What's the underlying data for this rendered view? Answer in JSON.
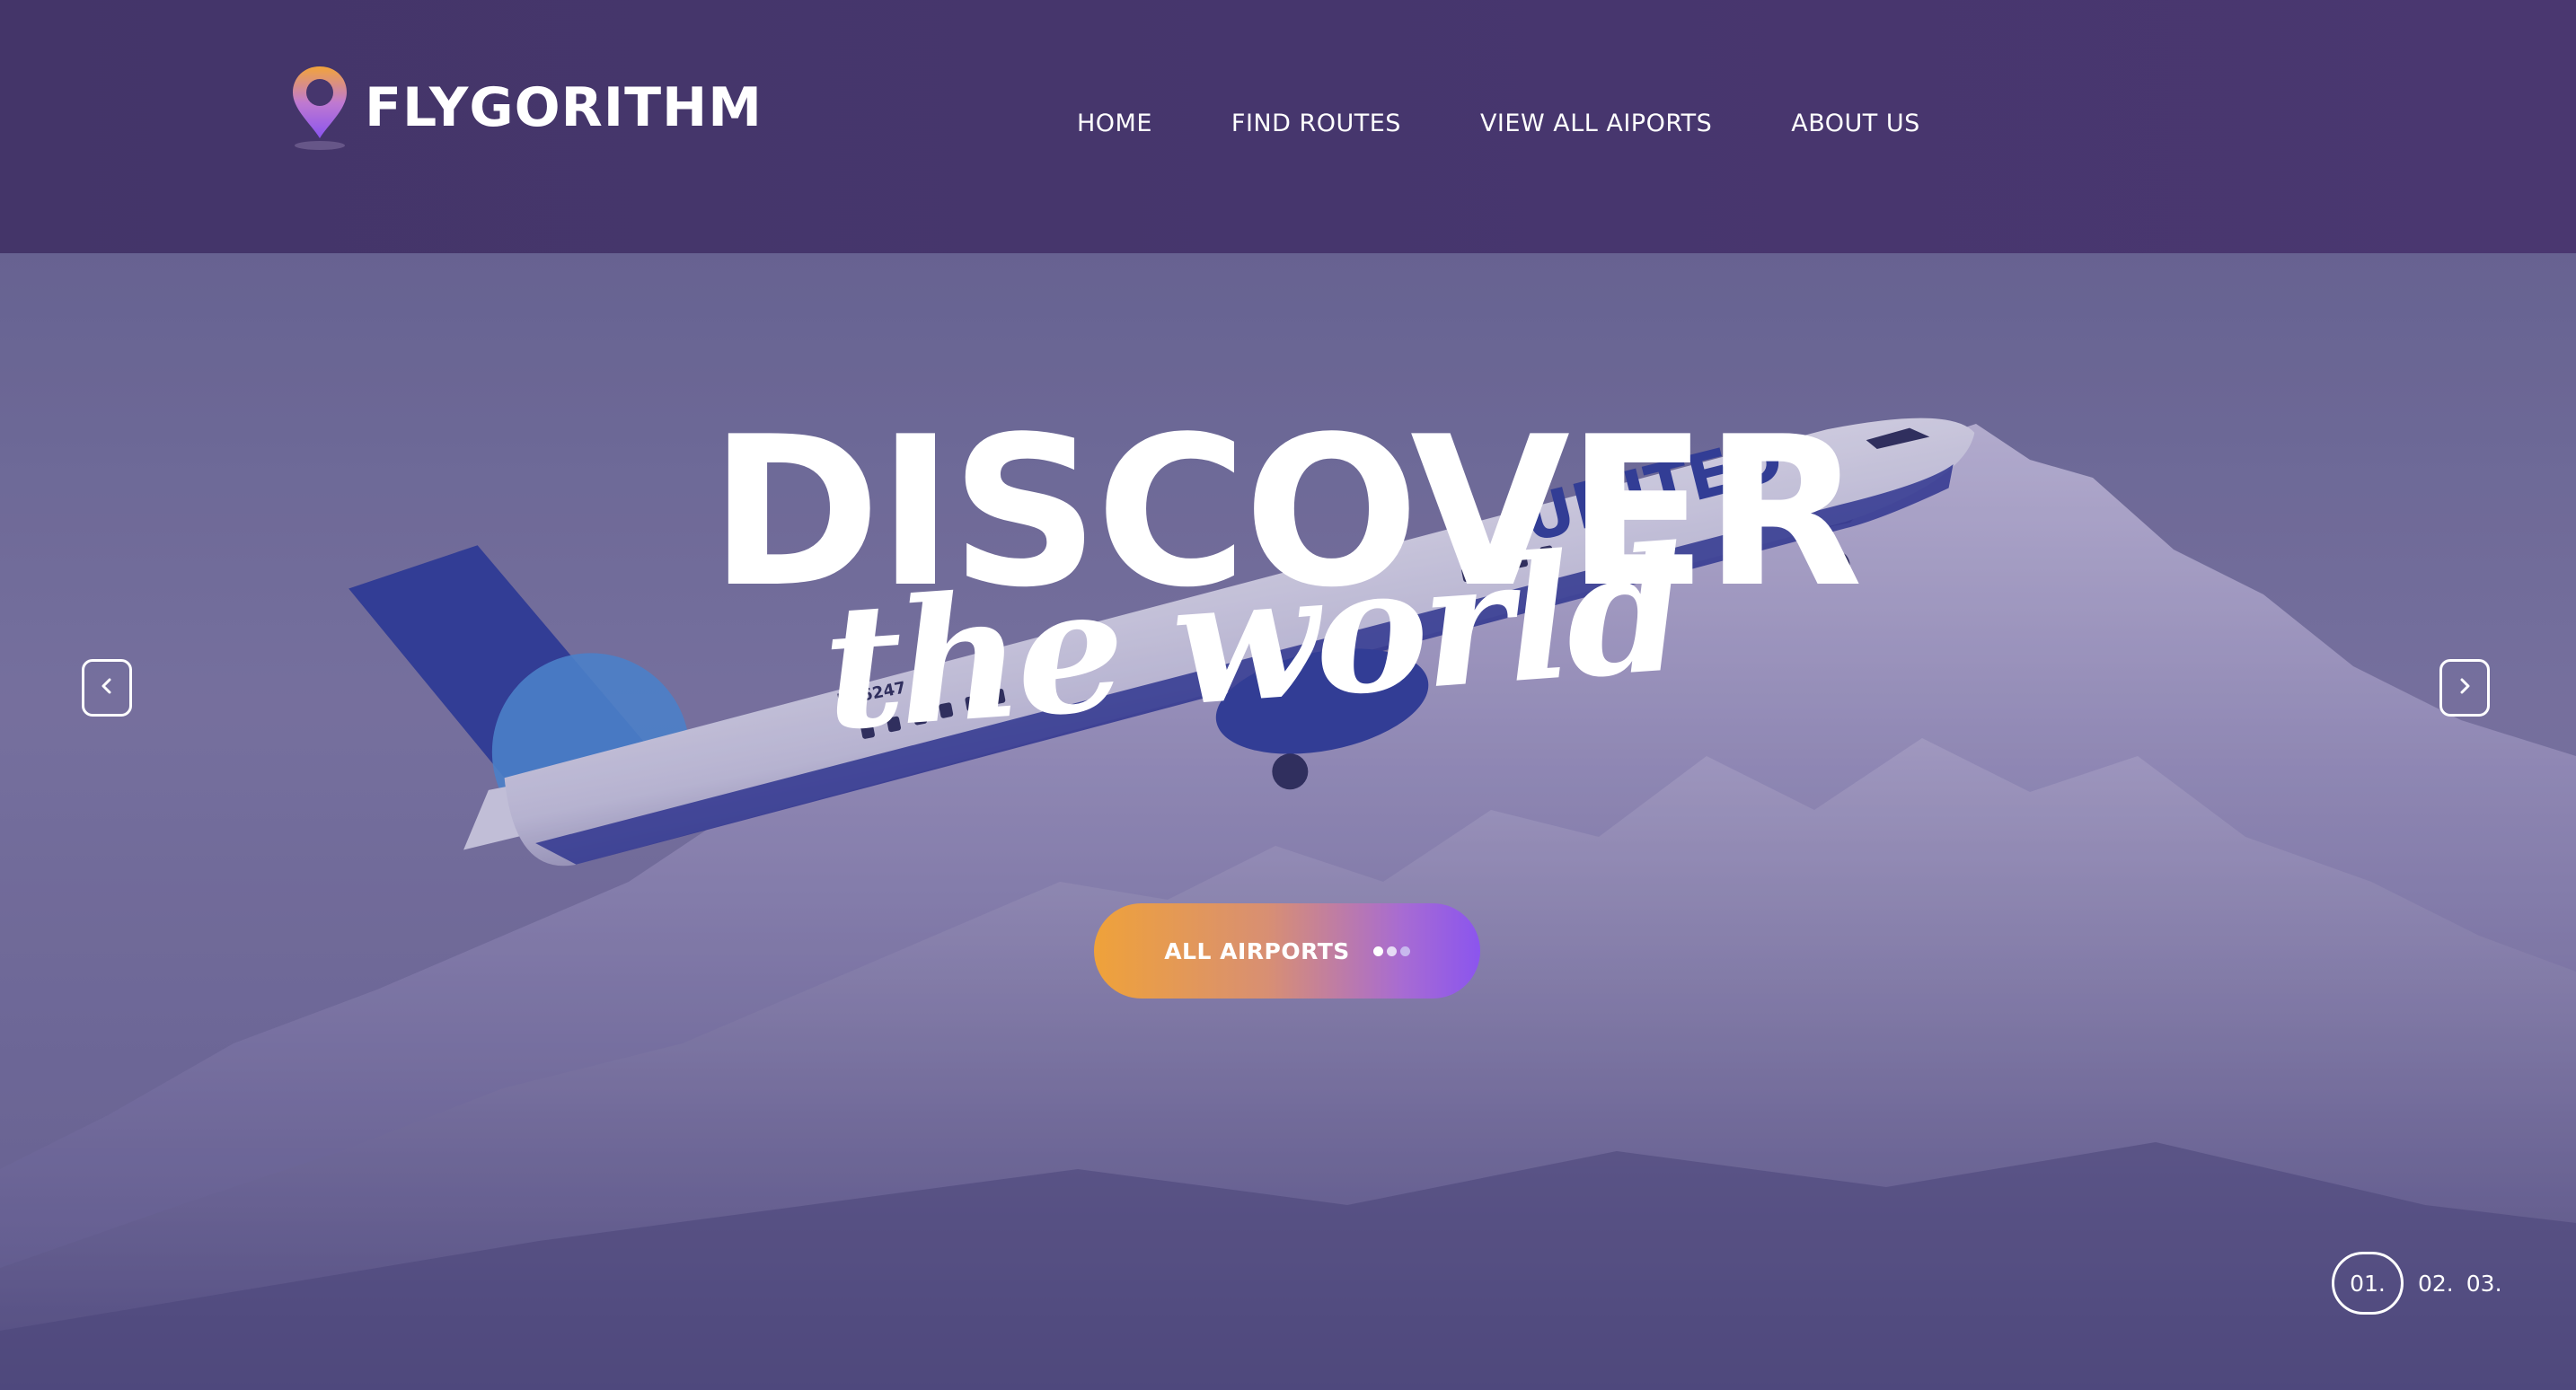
{
  "brand": {
    "name": "FLYGORITHM",
    "logo_icon": "map-pin-icon"
  },
  "nav": {
    "items": [
      {
        "label": "HOME"
      },
      {
        "label": "FIND ROUTES"
      },
      {
        "label": "VIEW ALL AIPORTS"
      },
      {
        "label": "ABOUT US"
      }
    ]
  },
  "hero": {
    "headline": "DISCOVER",
    "subheadline": "the world",
    "cta_label": "ALL AIRPORTS",
    "prev_icon": "chevron-left-icon",
    "next_icon": "chevron-right-icon",
    "background_image": "airplane over snowy mountains",
    "aircraft_registration": "N36247",
    "aircraft_livery": "UNITED",
    "pagination": [
      "01.",
      "02.",
      "03."
    ],
    "active_slide": "01."
  },
  "colors": {
    "header_bg": "#46366d",
    "hero_tint": "#6e6b93",
    "cta_gradient_start": "#efa23a",
    "cta_gradient_end": "#8b55ee",
    "text": "#ffffff"
  }
}
